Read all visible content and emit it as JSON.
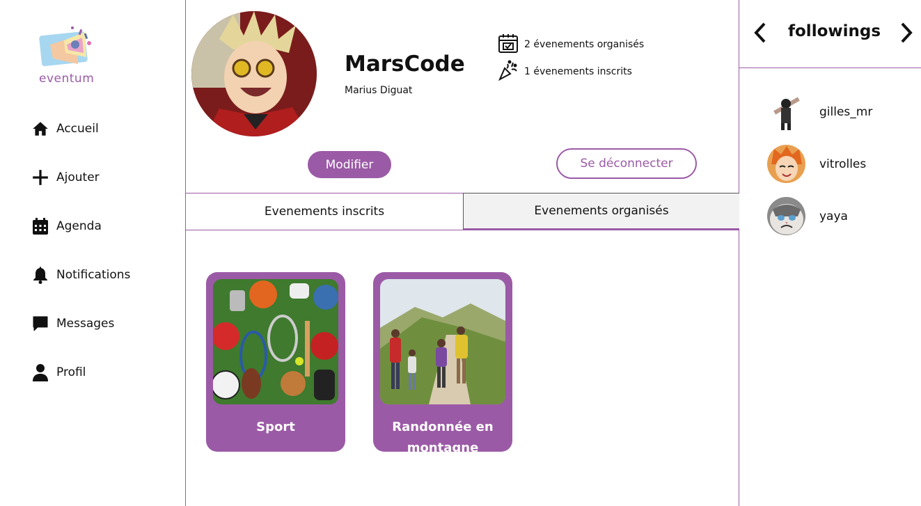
{
  "brand": {
    "logo_word": "eventum"
  },
  "nav": {
    "items": [
      {
        "label": "Accueil",
        "icon": "home-icon"
      },
      {
        "label": "Ajouter",
        "icon": "plus-icon"
      },
      {
        "label": "Agenda",
        "icon": "calendar-icon"
      },
      {
        "label": "Notifications",
        "icon": "bell-icon"
      },
      {
        "label": "Messages",
        "icon": "message-icon"
      },
      {
        "label": "Profil",
        "icon": "user-icon"
      }
    ]
  },
  "profile": {
    "username": "MarsCode",
    "fullname": "Marius Diguat",
    "stats": {
      "organized": "2 évenements organisés",
      "registered": "1 évenements inscrits"
    },
    "modify_label": "Modifier",
    "logout_label": "Se déconnecter"
  },
  "tabs": {
    "registered": "Evenements inscrits",
    "organized": "Evenements organisés",
    "active": "organized"
  },
  "events": [
    {
      "title": "Sport"
    },
    {
      "title": "Randonnée en montagne"
    }
  ],
  "followings": {
    "title": "followings",
    "users": [
      {
        "name": "gilles_mr"
      },
      {
        "name": "vitrolles"
      },
      {
        "name": "yaya"
      }
    ]
  },
  "colors": {
    "accent": "#9b5aa6",
    "tab_active_bg": "#f2f2f2"
  }
}
